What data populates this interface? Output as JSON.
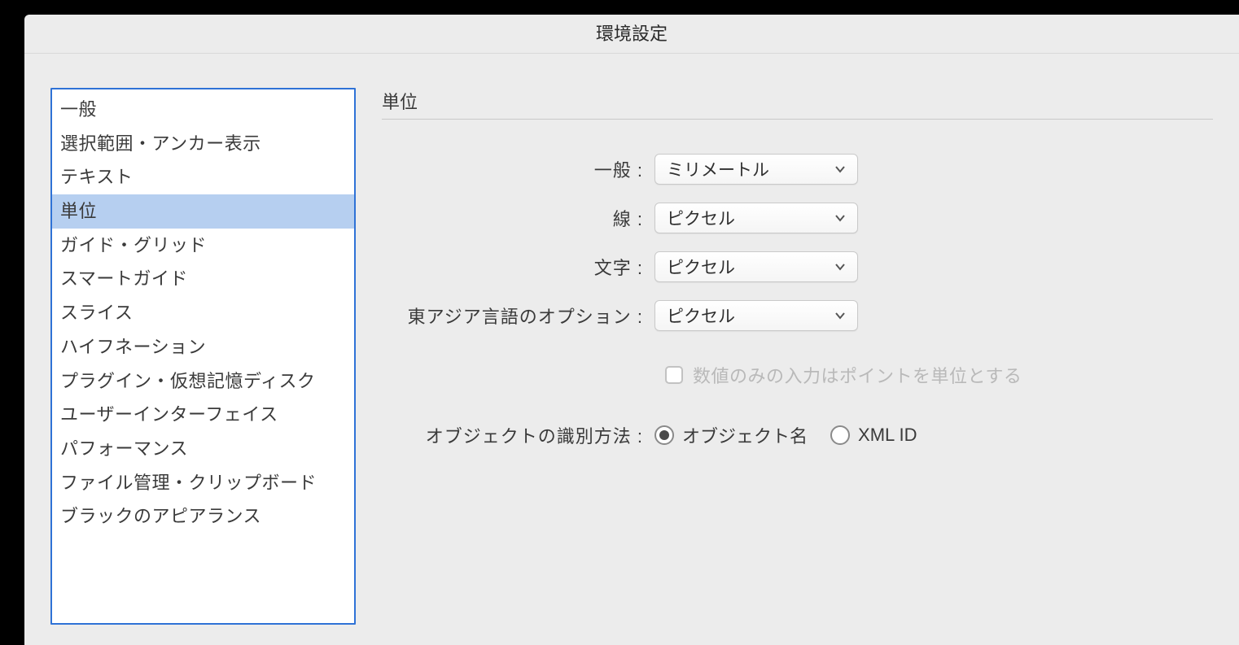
{
  "window": {
    "title": "環境設定"
  },
  "sidebar": {
    "items": [
      {
        "label": "一般"
      },
      {
        "label": "選択範囲・アンカー表示"
      },
      {
        "label": "テキスト"
      },
      {
        "label": "単位",
        "selected": true
      },
      {
        "label": "ガイド・グリッド"
      },
      {
        "label": "スマートガイド"
      },
      {
        "label": "スライス"
      },
      {
        "label": "ハイフネーション"
      },
      {
        "label": "プラグイン・仮想記憶ディスク"
      },
      {
        "label": "ユーザーインターフェイス"
      },
      {
        "label": "パフォーマンス"
      },
      {
        "label": "ファイル管理・クリップボード"
      },
      {
        "label": "ブラックのアピアランス"
      }
    ]
  },
  "main": {
    "section_title": "単位",
    "fields": {
      "general": {
        "label": "一般 :",
        "value": "ミリメートル"
      },
      "stroke": {
        "label": "線 :",
        "value": "ピクセル"
      },
      "type": {
        "label": "文字 :",
        "value": "ピクセル"
      },
      "asian": {
        "label": "東アジア言語のオプション :",
        "value": "ピクセル"
      }
    },
    "checkbox": {
      "label": "数値のみの入力はポイントを単位とする",
      "checked": false,
      "disabled": true
    },
    "identify": {
      "label": "オブジェクトの識別方法 :",
      "options": {
        "object_name": {
          "label": "オブジェクト名",
          "checked": true
        },
        "xml_id": {
          "label": "XML ID",
          "checked": false
        }
      }
    }
  }
}
